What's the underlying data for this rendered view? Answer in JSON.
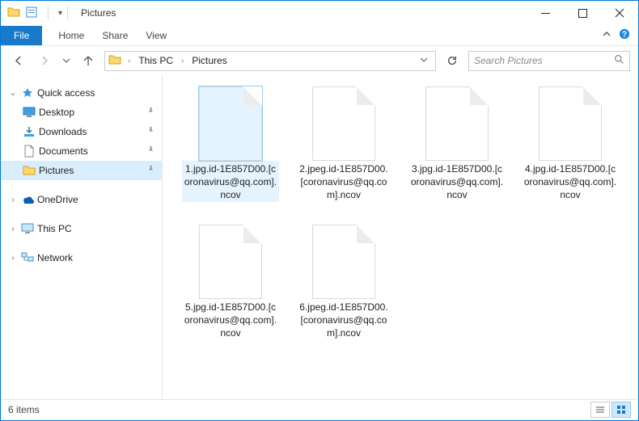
{
  "window": {
    "title": "Pictures"
  },
  "ribbon": {
    "file": "File",
    "tabs": [
      "Home",
      "Share",
      "View"
    ]
  },
  "address": {
    "crumbs": [
      "This PC",
      "Pictures"
    ]
  },
  "search": {
    "placeholder": "Search Pictures"
  },
  "sidebar": {
    "quick_access": "Quick access",
    "items": [
      {
        "label": "Desktop"
      },
      {
        "label": "Downloads"
      },
      {
        "label": "Documents"
      },
      {
        "label": "Pictures"
      }
    ],
    "onedrive": "OneDrive",
    "this_pc": "This PC",
    "network": "Network"
  },
  "files": [
    {
      "name": "1.jpg.id-1E857D00.[coronavirus@qq.com].ncov",
      "selected": true
    },
    {
      "name": "2.jpeg.id-1E857D00.[coronavirus@qq.com].ncov",
      "selected": false
    },
    {
      "name": "3.jpg.id-1E857D00.[coronavirus@qq.com].ncov",
      "selected": false
    },
    {
      "name": "4.jpg.id-1E857D00.[coronavirus@qq.com].ncov",
      "selected": false
    },
    {
      "name": "5.jpg.id-1E857D00.[coronavirus@qq.com].ncov",
      "selected": false
    },
    {
      "name": "6.jpeg.id-1E857D00.[coronavirus@qq.com].ncov",
      "selected": false
    }
  ],
  "status": {
    "count_text": "6 items"
  }
}
